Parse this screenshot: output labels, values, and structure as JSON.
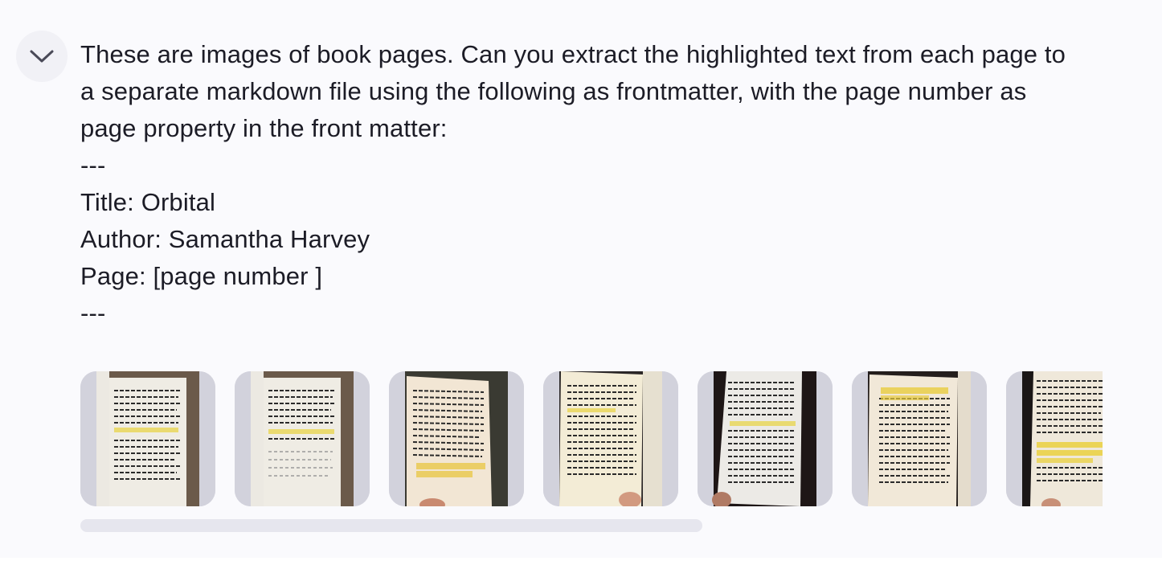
{
  "collapse_button": {
    "icon": "chevron-down-icon"
  },
  "message": {
    "lines": [
      "These are images of book pages. Can you extract the highlighted text from each page to",
      "a separate markdown file using the following as frontmatter, with the page number as",
      "page property in the front matter:",
      "---",
      "Title: Orbital",
      "Author: Samantha Harvey",
      "Page: [page number ]",
      "---"
    ]
  },
  "attachments": {
    "count_visible": 7,
    "items": [
      {
        "name": "book-page-photo-1",
        "highlight_color": "#e8d44a"
      },
      {
        "name": "book-page-photo-2",
        "highlight_color": "#e8d44a"
      },
      {
        "name": "book-page-photo-3",
        "highlight_color": "#e8c84a"
      },
      {
        "name": "book-page-photo-4",
        "highlight_color": "#e8d44a"
      },
      {
        "name": "book-page-photo-5",
        "highlight_color": "#e8d44a"
      },
      {
        "name": "book-page-photo-6",
        "highlight_color": "#e8cc40"
      },
      {
        "name": "book-page-photo-7",
        "highlight_color": "#ead03e"
      }
    ]
  },
  "colors": {
    "text": "#1c1c26",
    "panel_background": "#fafafd",
    "thumb_frame": "#d2d2dc",
    "scrollbar": "#e6e6ee"
  }
}
